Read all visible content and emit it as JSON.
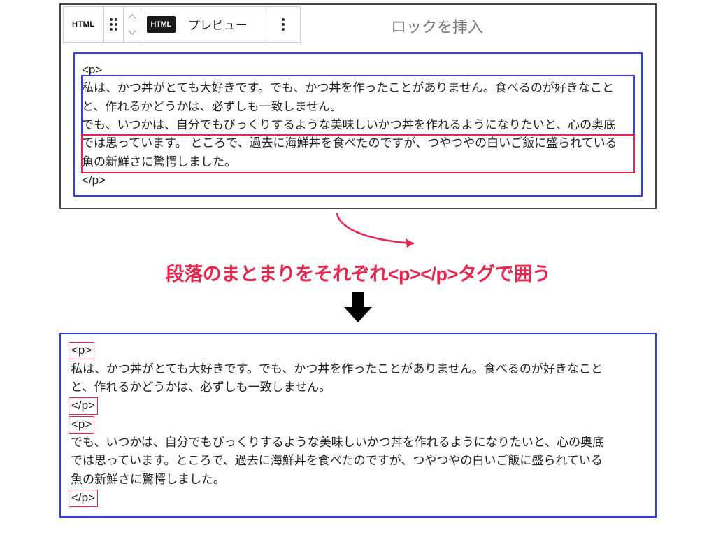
{
  "toolbar": {
    "html_label": "HTML",
    "html_badge": "HTML",
    "preview_label": "プレビュー",
    "placeholder": "ロックを挿入"
  },
  "code_top": {
    "p_open": "<p>",
    "line1a": "私は、かつ丼がとても大好きです。でも、かつ丼を作ったことがありません。食べるのが好きなこと",
    "line1b": "と、作れるかどうかは、必ずしも一致しません。",
    "line2a": "でも、いつかは、自分でもびっくりするような美味しいかつ丼を作れるようになりたいと、心の奥底",
    "line2b_part1": "では思っています。",
    "line2b_part2": "ところで、過去に海鮮丼を食べたのですが、つやつやの白いご飯に盛られている",
    "line2c": "魚の新鮮さに驚愕しました。",
    "p_close": "</p>"
  },
  "annotation": "段落のまとまりをそれぞれ<p></p>タグで囲う",
  "code_bottom": {
    "p_open": "<p>",
    "para1a": "私は、かつ丼がとても大好きです。でも、かつ丼を作ったことがありません。食べるのが好きなこと",
    "para1b": "と、作れるかどうかは、必ずしも一致しません。",
    "p_close1": "</p>",
    "p_open2": "<p>",
    "para2a": "でも、いつかは、自分でもびっくりするような美味しいかつ丼を作れるようになりたいと、心の奥底",
    "para2b": "では思っています。ところで、過去に海鮮丼を食べたのですが、つやつやの白いご飯に盛られている",
    "para2c": "魚の新鮮さに驚愕しました。",
    "p_close2": "</p>"
  }
}
